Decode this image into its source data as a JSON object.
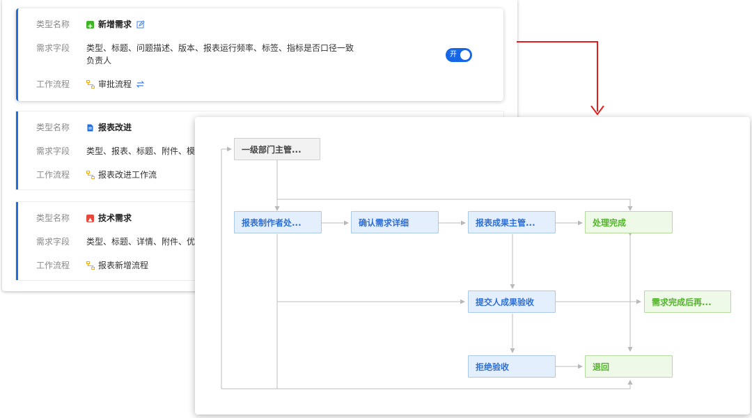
{
  "type_list": {
    "label_name": "类型名称",
    "label_fields": "需求字段",
    "label_workflow": "工作流程",
    "items": [
      {
        "name": "新增需求",
        "icon": "plus-square-icon",
        "color": "#3db522",
        "fields": "类型、标题、问题描述、版本、报表运行频率、标签、指标是否口径一致",
        "fields2": "负责人",
        "workflow": "审批流程",
        "toggle_label": "开"
      },
      {
        "name": "报表改进",
        "icon": "document-icon",
        "color": "#1f6fe0",
        "fields": "类型、报表、标题、附件、模",
        "workflow": "报表改进工作流"
      },
      {
        "name": "技术需求",
        "icon": "alert-square-icon",
        "color": "#e8473b",
        "fields": "类型、标题、详情、附件、优",
        "workflow": "报表新增流程"
      }
    ]
  },
  "flowchart": {
    "nodes": {
      "dept_head": "一级部门主管...",
      "report_maker": "报表制作者处...",
      "confirm_detail": "确认需求详细",
      "result_head": "报表成果主管...",
      "done": "处理完成",
      "submitter_accept": "提交人成果验收",
      "complete_again": "需求完成后再...",
      "reject_accept": "拒绝验收",
      "return_back": "退回"
    }
  },
  "colors": {
    "accent": "#1f6fe0",
    "connector": "#e41c1c",
    "edge": "#b9b9b9"
  }
}
